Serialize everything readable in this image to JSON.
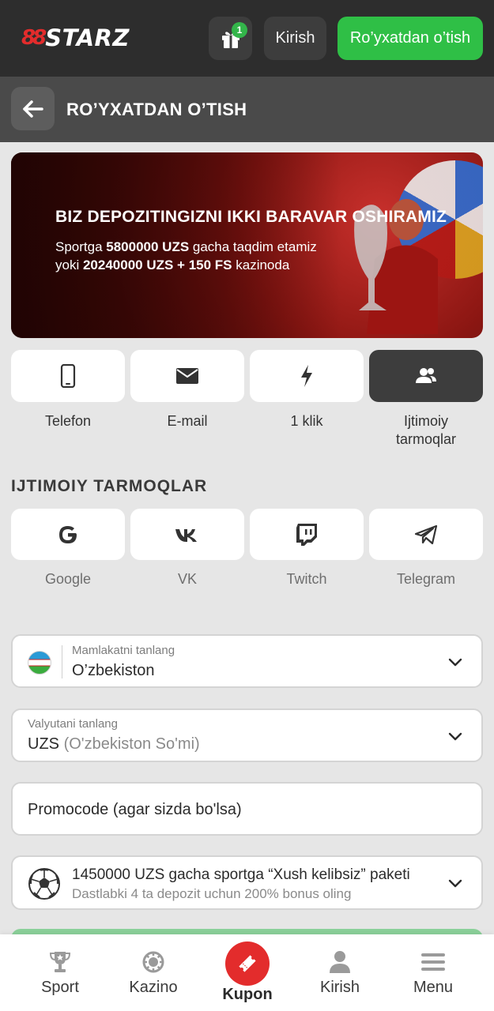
{
  "header": {
    "logo_mark": "88",
    "logo_word": "STARZ",
    "gift_count": "1",
    "login_label": "Kirish",
    "register_label": "Ro’yxatdan o’tish"
  },
  "titlebar": {
    "title": "RO’YXATDAN O’TISH"
  },
  "banner": {
    "headline": "BIZ DEPOZITINGIZNI IKKI BARAVAR OSHIRAMIZ",
    "line1_prefix": "Sportga ",
    "line1_amount": "5800000 UZS",
    "line1_suffix": " gacha taqdim etamiz",
    "line2_prefix": "yoki ",
    "line2_amount": "20240000 UZS + 150 FS",
    "line2_suffix": " kazinoda"
  },
  "methods": [
    {
      "label": "Telefon",
      "icon": "phone-icon"
    },
    {
      "label": "E-mail",
      "icon": "envelope-icon"
    },
    {
      "label": "1 klik",
      "icon": "lightning-icon"
    },
    {
      "label_line1": "Ijtimoiy",
      "label_line2": "tarmoqlar",
      "icon": "users-icon",
      "active": true
    }
  ],
  "social_section": {
    "title": "IJTIMOIY TARMOQLAR",
    "items": [
      {
        "label": "Google",
        "icon": "google-icon"
      },
      {
        "label": "VK",
        "icon": "vk-icon"
      },
      {
        "label": "Twitch",
        "icon": "twitch-icon"
      },
      {
        "label": "Telegram",
        "icon": "telegram-icon"
      }
    ]
  },
  "form": {
    "country": {
      "label": "Mamlakatni tanlang",
      "value": "O’zbekiston"
    },
    "currency": {
      "label": "Valyutani tanlang",
      "code": "UZS",
      "name": "(O'zbekiston So'mi)"
    },
    "promocode": {
      "placeholder": "Promocode (agar sizda bo'lsa)"
    },
    "bonus": {
      "title": "1450000 UZS gacha sportga “Xush kelibsiz” paketi",
      "subtitle": "Dastlabki 4 ta depozit uchun 200% bonus oling"
    }
  },
  "bottom_nav": {
    "items": [
      {
        "label": "Sport",
        "icon": "trophy-icon"
      },
      {
        "label": "Kazino",
        "icon": "casino-chip-icon"
      },
      {
        "label": "Kupon",
        "icon": "ticket-icon"
      },
      {
        "label": "Kirish",
        "icon": "user-icon"
      },
      {
        "label": "Menu",
        "icon": "hamburger-icon"
      }
    ]
  },
  "colors": {
    "brand_red": "#e32c2c",
    "accent_green": "#2fbf46",
    "header_bg": "#2d2d2d",
    "titlebar_bg": "#4a4a4a"
  }
}
